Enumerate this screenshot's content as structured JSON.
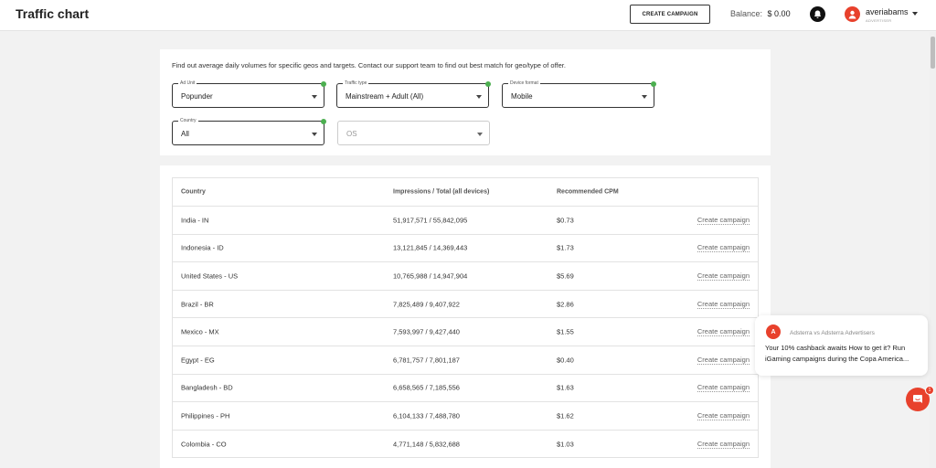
{
  "header": {
    "title": "Traffic chart",
    "create_campaign_label": "CREATE CAMPAIGN",
    "balance_label": "Balance:",
    "balance_value": "$ 0.00",
    "username": "averiabams",
    "role": "ADVERTISER"
  },
  "filters": {
    "intro": "Find out average daily volumes for specific geos and targets. Contact our support team to find out best match for geo/type of offer.",
    "ad_unit": {
      "label": "Ad Unit",
      "value": "Popunder"
    },
    "traffic_type": {
      "label": "Traffic type",
      "value": "Mainstream + Adult (All)"
    },
    "device_format": {
      "label": "Device format",
      "value": "Mobile"
    },
    "country": {
      "label": "Country",
      "value": "All"
    },
    "os": {
      "placeholder": "OS"
    }
  },
  "table": {
    "headers": [
      "Country",
      "Impressions / Total (all devices)",
      "Recommended CPM"
    ],
    "action_label": "Create campaign",
    "rows": [
      {
        "country": "India - IN",
        "impressions": "51,917,571 / 55,842,095",
        "cpm": "$0.73"
      },
      {
        "country": "Indonesia - ID",
        "impressions": "13,121,845 / 14,369,443",
        "cpm": "$1.73"
      },
      {
        "country": "United States - US",
        "impressions": "10,765,988 / 14,947,904",
        "cpm": "$5.69"
      },
      {
        "country": "Brazil - BR",
        "impressions": "7,825,489 / 9,407,922",
        "cpm": "$2.86"
      },
      {
        "country": "Mexico - MX",
        "impressions": "7,593,997 / 9,427,440",
        "cpm": "$1.55"
      },
      {
        "country": "Egypt - EG",
        "impressions": "6,781,757 / 7,801,187",
        "cpm": "$0.40"
      },
      {
        "country": "Bangladesh - BD",
        "impressions": "6,658,565 / 7,185,556",
        "cpm": "$1.63"
      },
      {
        "country": "Philippines - PH",
        "impressions": "6,104,133 / 7,488,780",
        "cpm": "$1.62"
      },
      {
        "country": "Colombia - CO",
        "impressions": "4,771,148 / 5,832,688",
        "cpm": "$1.03"
      }
    ]
  },
  "notification": {
    "avatar_letter": "A",
    "sender": "Adsterra vs Adsterra Advertisers",
    "message": "Your 10% cashback awaits How to get it? Run iGaming campaigns during the Copa America..."
  },
  "chat": {
    "badge": "1"
  },
  "colors": {
    "accent": "#e8412c",
    "status_dot": "#4caf50"
  }
}
